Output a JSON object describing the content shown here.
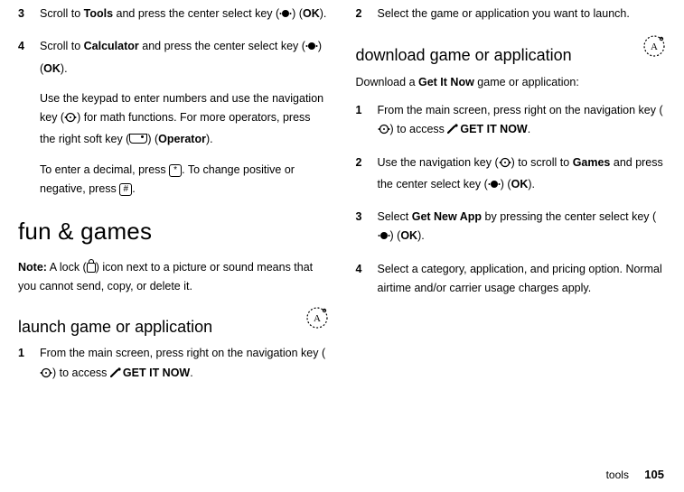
{
  "left": {
    "step3_num": "3",
    "step3_a": "Scroll to ",
    "step3_tools": "Tools",
    "step3_b": " and press the center select key (",
    "step3_c": ") (",
    "step3_ok": "OK",
    "step3_d": ").",
    "step4_num": "4",
    "step4_a": "Scroll to ",
    "step4_calc": "Calculator",
    "step4_b": " and press the center select key (",
    "step4_c": ") (",
    "step4_ok": "OK",
    "step4_d": ").",
    "para1_a": "Use the keypad to enter numbers and use the navigation key (",
    "para1_b": ") for math functions. For more operators, press the right soft key (",
    "para1_c": ") (",
    "para1_op": "Operator",
    "para1_d": ").",
    "para2_a": "To enter a decimal, press ",
    "para2_star": "*",
    "para2_b": ". To change positive or negative, press ",
    "para2_hash": "#",
    "para2_c": ".",
    "h1": "fun & games",
    "note_label": "Note:",
    "note_a": " A lock (",
    "note_b": ") icon next to a picture or sound means that you cannot send, copy, or delete it.",
    "h2": "launch game or application",
    "l1_num": "1",
    "l1_a": "From the main screen, press right on the navigation key (",
    "l1_b": ") to access  ",
    "l1_git": "GET IT NOW",
    "l1_c": "."
  },
  "right": {
    "r2_num": "2",
    "r2_a": "Select the game or application you want to launch.",
    "h2": "download game or application",
    "intro_a": "Download a ",
    "intro_git": "Get It Now",
    "intro_b": " game or application:",
    "d1_num": "1",
    "d1_a": "From the main screen, press right on the navigation key (",
    "d1_b": ") to access  ",
    "d1_git": "GET IT NOW",
    "d1_c": ".",
    "d2_num": "2",
    "d2_a": "Use the navigation key (",
    "d2_b": ") to scroll to  ",
    "d2_games": "Games",
    "d2_c": " and press the center select key (",
    "d2_d": ") (",
    "d2_ok": "OK",
    "d2_e": ").",
    "d3_num": "3",
    "d3_a": "Select  ",
    "d3_app": "Get New App",
    "d3_b": " by pressing the center select key (",
    "d3_c": ") (",
    "d3_ok": "OK",
    "d3_d": ").",
    "d4_num": "4",
    "d4_a": "Select a category, application, and pricing option. Normal airtime and/or carrier usage charges apply."
  },
  "footer": {
    "section": "tools",
    "page": "105"
  }
}
